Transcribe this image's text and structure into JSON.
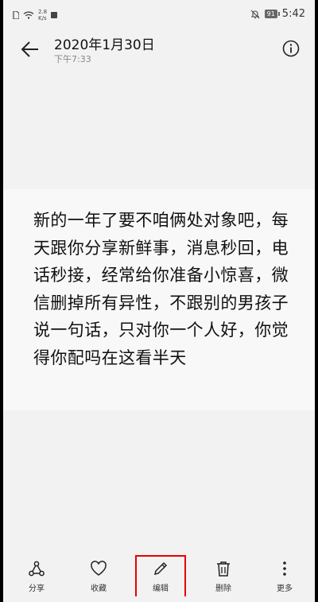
{
  "status_bar": {
    "speed_value": "2.8",
    "speed_unit": "K/s",
    "battery": "91",
    "time": "5:42"
  },
  "header": {
    "title": "2020年1月30日",
    "subtitle": "下午7:33",
    "back_icon": "arrow-left-icon",
    "info_icon": "info-icon"
  },
  "note": {
    "text": "新的一年了要不咱俩处对象吧，每天跟你分享新鲜事，消息秒回，电话秒接，经常给你准备小惊喜，微信删掉所有异性，不跟别的男孩子说一句话，只对你一个人好，你觉得你配吗在这看半天"
  },
  "toolbar": {
    "share_label": "分享",
    "favorite_label": "收藏",
    "edit_label": "编辑",
    "delete_label": "删除",
    "more_label": "更多"
  },
  "colors": {
    "highlight": "#e60000",
    "background": "#f2f2f2"
  }
}
